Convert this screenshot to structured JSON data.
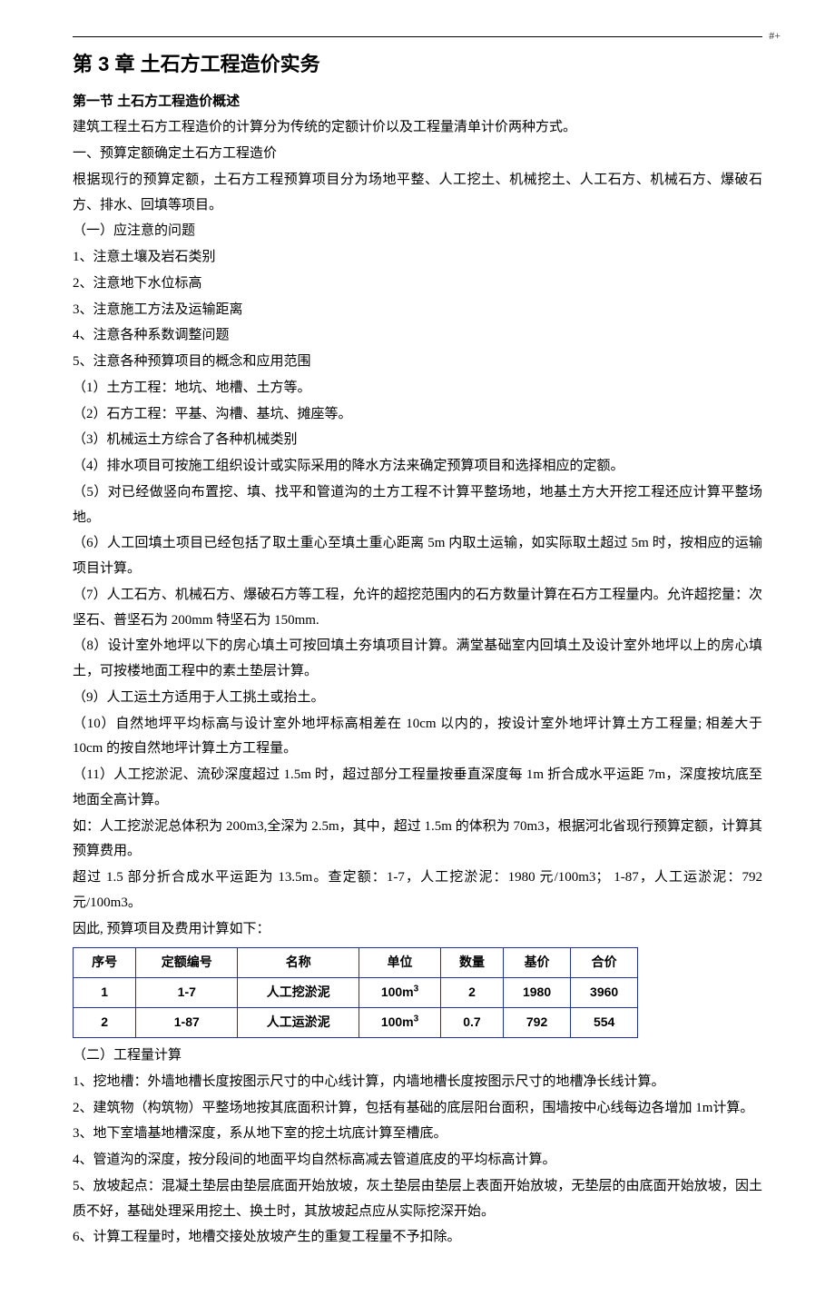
{
  "pageMark": "#+",
  "title": "第 3 章  土石方工程造价实务",
  "section1": "第一节  土石方工程造价概述",
  "paragraphs": [
    "建筑工程土石方工程造价的计算分为传统的定额计价以及工程量清单计价两种方式。",
    "一、预算定额确定土石方工程造价",
    "根据现行的预算定额，土石方工程预算项目分为场地平整、人工挖土、机械挖土、人工石方、机械石方、爆破石方、排水、回填等项目。",
    "（一）应注意的问题",
    "1、注意土壤及岩石类别",
    "2、注意地下水位标高",
    "3、注意施工方法及运输距离",
    "4、注意各种系数调整问题",
    "5、注意各种预算项目的概念和应用范围",
    "（1）土方工程：地坑、地槽、土方等。",
    "（2）石方工程：平基、沟槽、基坑、摊座等。",
    "（3）机械运土方综合了各种机械类别",
    "（4）排水项目可按施工组织设计或实际采用的降水方法来确定预算项目和选择相应的定额。",
    "（5）对已经做竖向布置挖、填、找平和管道沟的土方工程不计算平整场地，地基土方大开挖工程还应计算平整场地。",
    "（6）人工回填土项目已经包括了取土重心至填土重心距离 5m 内取土运输，如实际取土超过 5m 时，按相应的运输项目计算。",
    "（7）人工石方、机械石方、爆破石方等工程，允许的超挖范围内的石方数量计算在石方工程量内。允许超挖量：次坚石、普坚石为 200mm 特坚石为 150mm.",
    "（8）设计室外地坪以下的房心填土可按回填土夯填项目计算。满堂基础室内回填土及设计室外地坪以上的房心填土，可按楼地面工程中的素土垫层计算。",
    "（9）人工运土方适用于人工挑土或抬土。",
    "（10）自然地坪平均标高与设计室外地坪标高相差在 10cm 以内的，按设计室外地坪计算土方工程量; 相差大于 10cm 的按自然地坪计算土方工程量。",
    "（11）人工挖淤泥、流砂深度超过 1.5m 时，超过部分工程量按垂直深度每 1m 折合成水平运距 7m，深度按坑底至地面全高计算。",
    "如：人工挖淤泥总体积为 200m3,全深为 2.5m，其中，超过 1.5m 的体积为 70m3，根据河北省现行预算定额，计算其预算费用。",
    "超过 1.5 部分折合成水平运距为 13.5m。查定额：1-7，人工挖淤泥：1980 元/100m3；  1-87，人工运淤泥：792元/100m3。",
    "因此, 预算项目及费用计算如下："
  ],
  "table": {
    "headers": [
      "序号",
      "定额编号",
      "名称",
      "单位",
      "数量",
      "基价",
      "合价"
    ],
    "rows": [
      [
        "1",
        "1-7",
        "人工挖淤泥",
        "100m³",
        "2",
        "1980",
        "3960"
      ],
      [
        "2",
        "1-87",
        "人工运淤泥",
        "100m³",
        "0.7",
        "792",
        "554"
      ]
    ]
  },
  "afterTable": [
    "（二）工程量计算",
    "1、挖地槽：外墙地槽长度按图示尺寸的中心线计算，内墙地槽长度按图示尺寸的地槽净长线计算。",
    "2、建筑物（构筑物）平整场地按其底面积计算，包括有基础的底层阳台面积，围墙按中心线每边各增加 1m计算。",
    "3、地下室墙基地槽深度，系从地下室的挖土坑底计算至槽底。",
    "4、管道沟的深度，按分段间的地面平均自然标高减去管道底皮的平均标高计算。",
    "5、放坡起点：混凝土垫层由垫层底面开始放坡，灰土垫层由垫层上表面开始放坡，无垫层的由底面开始放坡，因土质不好，基础处理采用挖土、换土时，其放坡起点应从实际挖深开始。",
    "6、计算工程量时，地槽交接处放坡产生的重复工程量不予扣除。"
  ]
}
